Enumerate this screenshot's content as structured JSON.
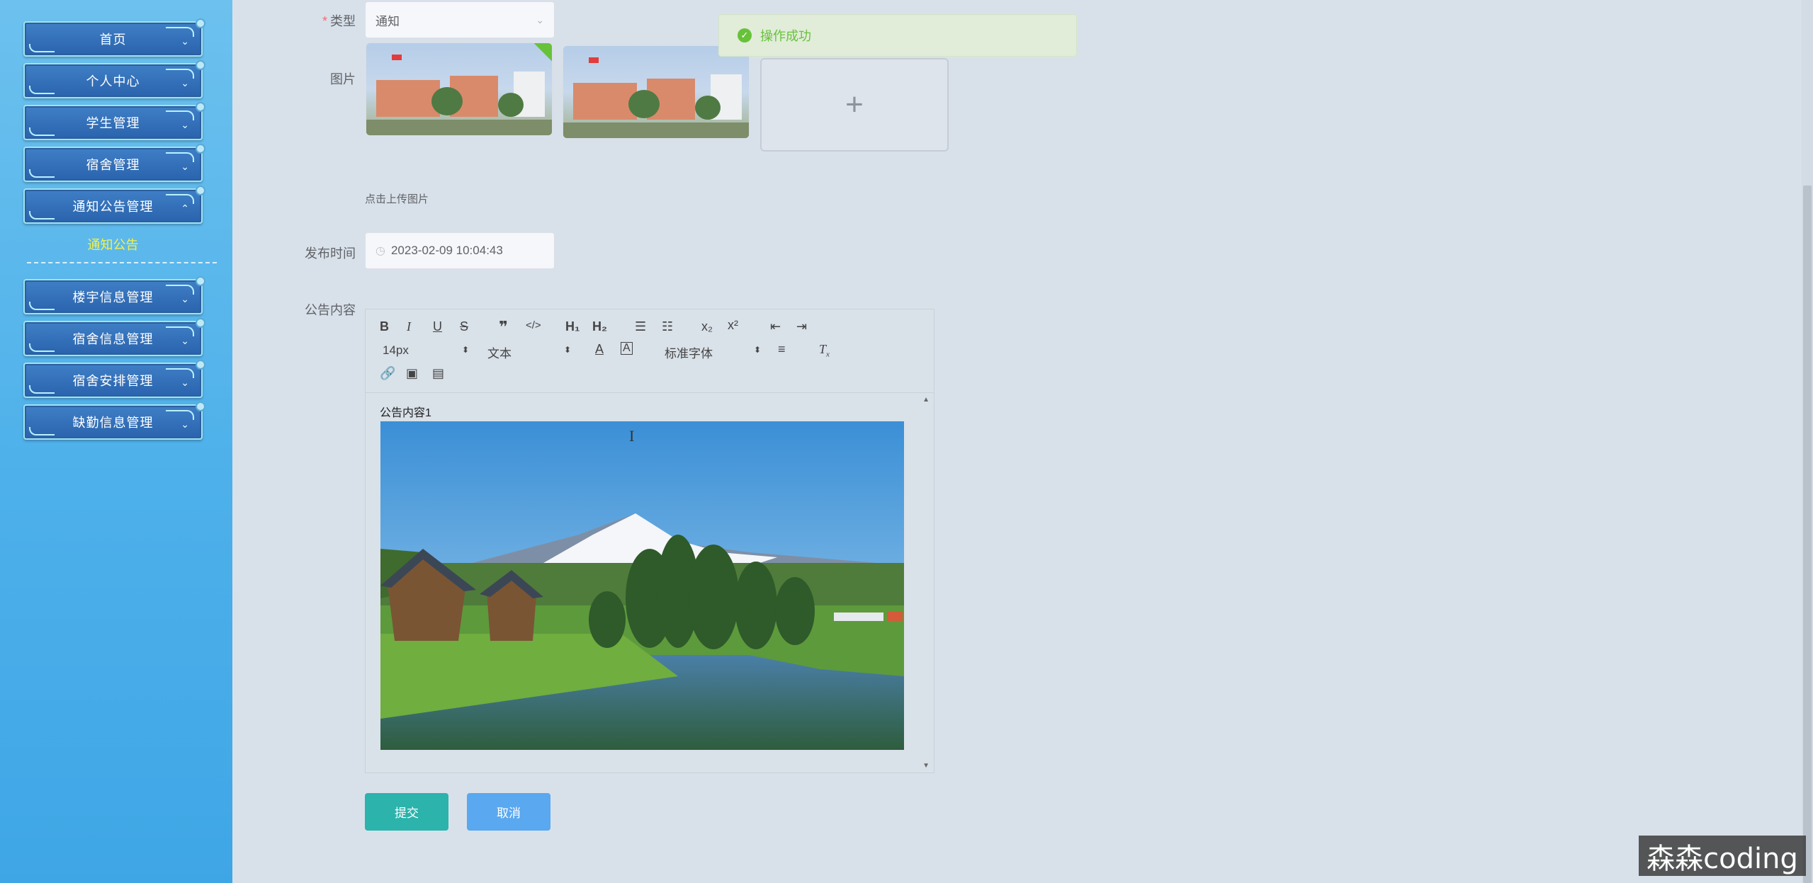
{
  "sidebar": {
    "items": [
      {
        "label": "首页"
      },
      {
        "label": "个人中心"
      },
      {
        "label": "学生管理"
      },
      {
        "label": "宿舍管理"
      },
      {
        "label": "通知公告管理"
      },
      {
        "label": "楼宇信息管理"
      },
      {
        "label": "宿舍信息管理"
      },
      {
        "label": "宿舍安排管理"
      },
      {
        "label": "缺勤信息管理"
      }
    ],
    "submenu_active": "通知公告"
  },
  "form": {
    "type": {
      "label": "类型",
      "required_mark": "*",
      "value": "通知"
    },
    "image": {
      "label": "图片",
      "hint": "点击上传图片",
      "add_icon": "+"
    },
    "publish_time": {
      "label": "发布时间",
      "value": "2023-02-09 10:04:43"
    },
    "content": {
      "label": "公告内容",
      "text": "公告内容1",
      "toolbar": {
        "font_size": "14px",
        "block_format": "文本",
        "font_family": "标准字体"
      }
    }
  },
  "buttons": {
    "submit": "提交",
    "cancel": "取消"
  },
  "toast": {
    "message": "操作成功"
  },
  "watermark": "森森coding",
  "colors": {
    "sidebar_top": "#6cc1ee",
    "submit": "#2bb3ac",
    "cancel": "#5aa8ef",
    "success": "#67c23a",
    "submenu_active": "#f1f14a"
  }
}
